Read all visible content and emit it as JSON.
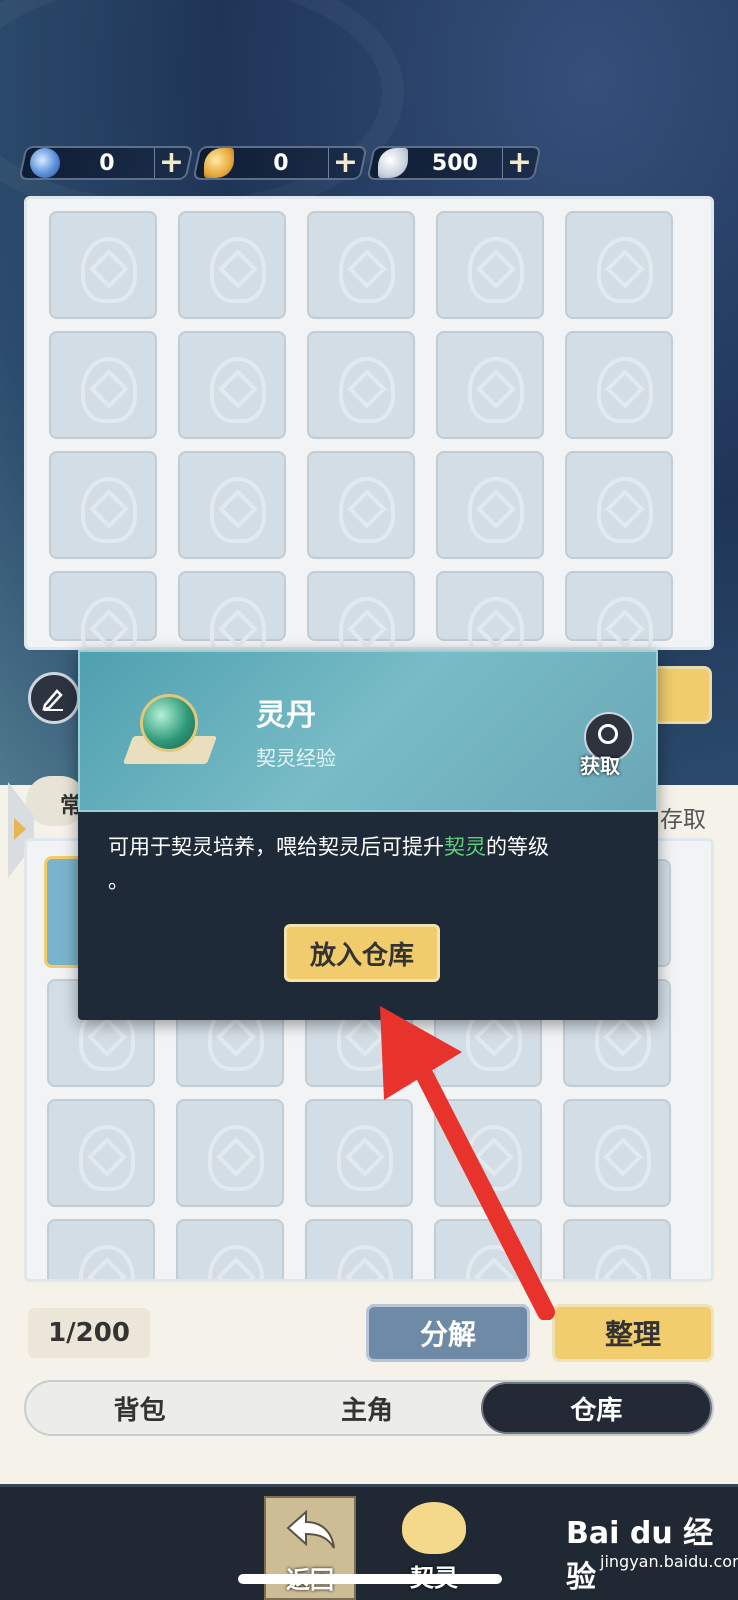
{
  "currencies": [
    {
      "icon": "blue-orb-icon",
      "value": "0",
      "plus": "+"
    },
    {
      "icon": "gold-leaf-icon",
      "value": "0",
      "plus": "+"
    },
    {
      "icon": "white-feather-icon",
      "value": "500",
      "plus": "+"
    }
  ],
  "filter_chip": {
    "left_label": "常",
    "right_label": "存取"
  },
  "popup": {
    "item_name": "灵丹",
    "item_type": "契灵经验",
    "get_label": "获取",
    "desc_before": "可用于契灵培养，喂给契灵后可提升",
    "desc_highlight": "契灵",
    "desc_after": "的等级",
    "desc_tail": "。",
    "store_button": "放入仓库"
  },
  "inventory": {
    "count": "1/200"
  },
  "actions": {
    "decompose": "分解",
    "sort": "整理"
  },
  "tabs": [
    {
      "label": "背包",
      "active": false
    },
    {
      "label": "主角",
      "active": false
    },
    {
      "label": "仓库",
      "active": true
    }
  ],
  "bottom_nav": {
    "back": "返回",
    "pet": "契灵"
  },
  "watermark": {
    "main": "Bai du 经验",
    "sub": "jingyan.baidu.com"
  },
  "colors": {
    "accent_gold": "#f0cc6c",
    "highlight_green": "#5bd27a",
    "arrow_red": "#e8322c"
  }
}
